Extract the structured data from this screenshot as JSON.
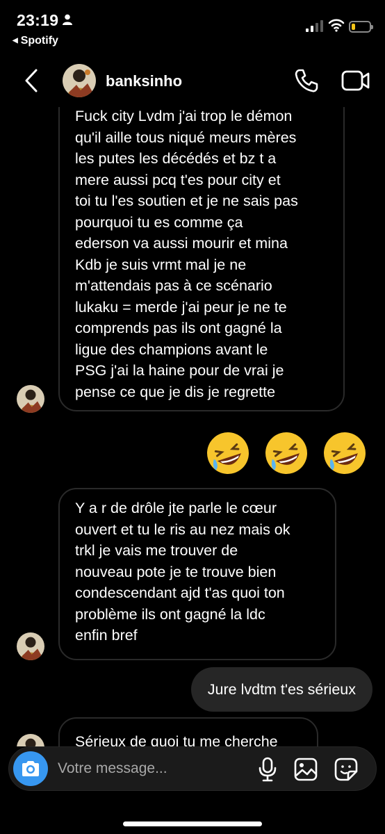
{
  "status_bar": {
    "time": "23:19",
    "back_app": "Spotify",
    "battery_level": 0.2,
    "battery_color": "#f5c518"
  },
  "header": {
    "username": "banksinho",
    "icons": [
      "back-chevron-icon",
      "phone-icon",
      "video-camera-icon"
    ]
  },
  "messages": [
    {
      "direction": "incoming",
      "text": "Fuck city Lvdm j'ai trop le démon\nqu'il aille tous niqué meurs mères\nles putes les décédés et bz t a\nmere aussi pcq t'es pour city et\ntoi tu l'es soutien et je ne sais pas\npourquoi tu es comme ça\nederson va aussi mourir et mina\nKdb je suis vrmt mal je ne\nm'attendais pas à ce scénario\nlukaku = merde j'ai peur je ne te\ncomprends pas ils ont gagné la\nligue des champions avant le\nPSG j'ai la haine pour de vrai je\npense ce que je dis je regrette"
    },
    {
      "direction": "outgoing",
      "emojis": [
        "🤣",
        "🤣",
        "🤣"
      ]
    },
    {
      "direction": "incoming",
      "text": "Y a r de drôle jte parle le cœur\nouvert et tu le ris au nez mais ok\ntrkl je vais me trouver de\nnouveau pote je te trouve bien\ncondescendant ajd t'as quoi ton\nproblème ils ont gagné la ldc\nenfin bref"
    },
    {
      "direction": "outgoing",
      "text": "Jure lvdtm t'es sérieux"
    },
    {
      "direction": "incoming",
      "text": "Sérieux de quoi tu me cherche"
    }
  ],
  "composer": {
    "placeholder": "Votre message...",
    "accent": "#3797f0",
    "icons": [
      "camera-icon",
      "microphone-icon",
      "gallery-icon",
      "sticker-icon"
    ]
  }
}
